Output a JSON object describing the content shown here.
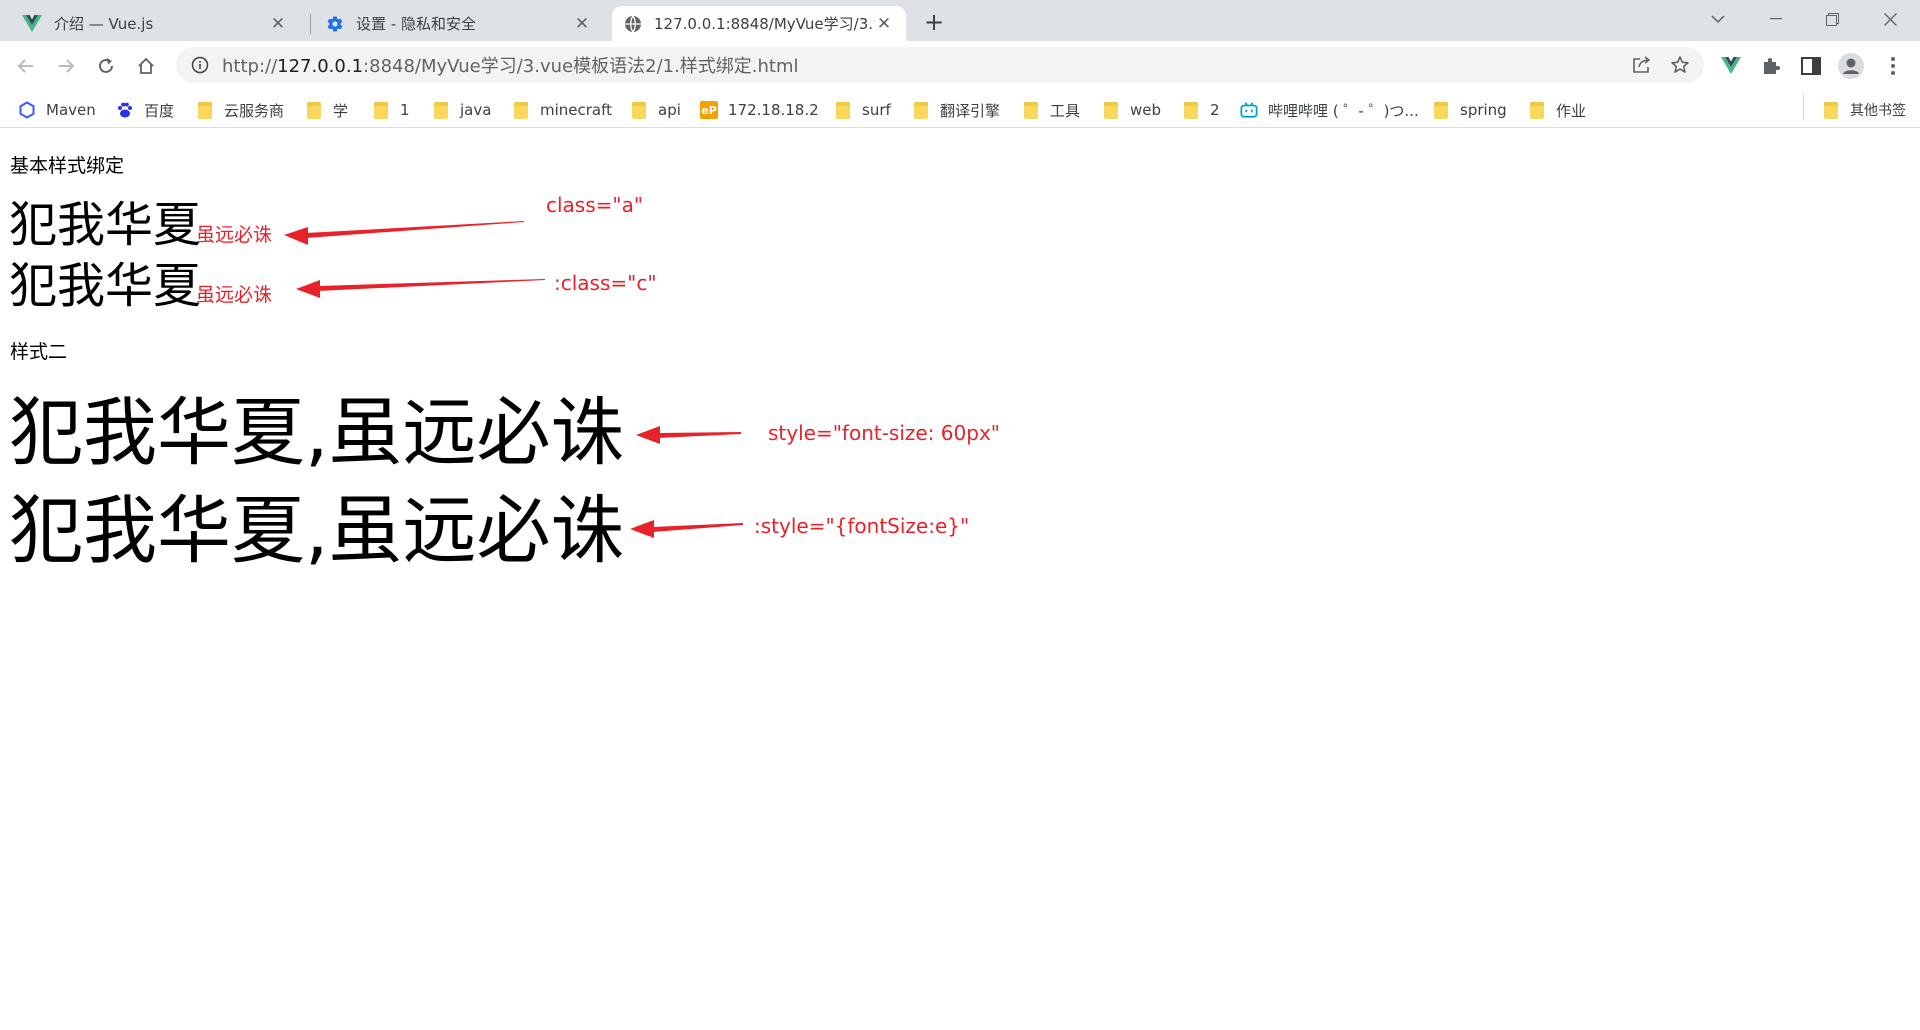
{
  "browser": {
    "tabs": [
      {
        "title": "介绍 — Vue.js",
        "icon": "vue-logo-icon",
        "active": false
      },
      {
        "title": "设置 - 隐私和安全",
        "icon": "gear-icon",
        "active": false
      },
      {
        "title": "127.0.0.1:8848/MyVue学习/3.v",
        "icon": "globe-icon",
        "active": true
      }
    ],
    "omnibox": {
      "url_host": "127.0.0.1",
      "url_prefix": "http://",
      "url_rest": ":8848/MyVue学习/3.vue模板语法2/1.样式绑定.html"
    },
    "bookmarks": [
      {
        "label": "Maven",
        "icon": "maven-icon"
      },
      {
        "label": "百度",
        "icon": "baidu-paw-icon"
      },
      {
        "label": "云服务商",
        "icon": "folder-icon"
      },
      {
        "label": "学",
        "icon": "folder-icon"
      },
      {
        "label": "1",
        "icon": "folder-icon"
      },
      {
        "label": "java",
        "icon": "folder-icon"
      },
      {
        "label": "minecraft",
        "icon": "folder-icon"
      },
      {
        "label": "api",
        "icon": "folder-icon"
      },
      {
        "label": "172.18.18.2",
        "icon": "ep-icon"
      },
      {
        "label": "surf",
        "icon": "folder-icon"
      },
      {
        "label": "翻译引擎",
        "icon": "folder-icon"
      },
      {
        "label": "工具",
        "icon": "folder-icon"
      },
      {
        "label": "web",
        "icon": "folder-icon"
      },
      {
        "label": "2",
        "icon": "folder-icon"
      },
      {
        "label": "哔哩哔哩 ( ゜- ゜)つ...",
        "icon": "bilibili-icon"
      },
      {
        "label": "spring",
        "icon": "folder-icon"
      },
      {
        "label": "作业",
        "icon": "folder-icon"
      }
    ],
    "other_bookmarks": "其他书签"
  },
  "page": {
    "section1_title": "基本样式绑定",
    "line1_big": "犯我华夏",
    "line1_small": "虽远必诛",
    "line2_big": "犯我华夏",
    "line2_small": "虽远必诛",
    "section2_title": "样式二",
    "line3": "犯我华夏,虽远必诛",
    "line4": "犯我华夏,虽远必诛"
  },
  "annotations": {
    "a1": "class=\"a\"",
    "a2": ":class=\"c\"",
    "a3": "style=\"font-size: 60px\"",
    "a4": ":style=\"{fontSize:e}\""
  },
  "colors": {
    "annotation": "#e8222a",
    "tabstrip": "#dee1e6",
    "omnibox": "#f1f3f4"
  }
}
